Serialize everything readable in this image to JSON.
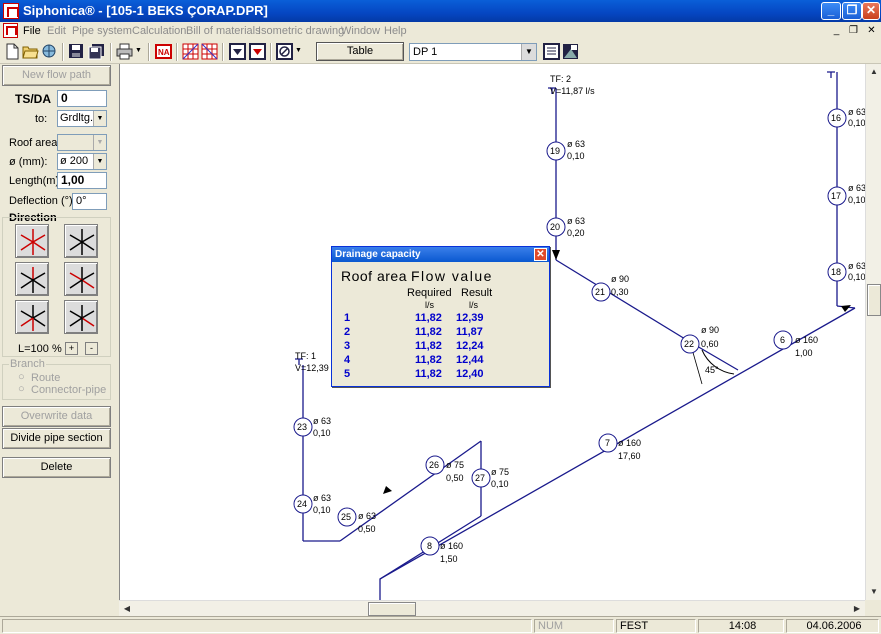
{
  "window": {
    "title": "Siphonica® - [105-1 BEKS ÇORAP.DPR]",
    "minimize": "_",
    "restore": "❐",
    "close": "✕"
  },
  "menu": {
    "items": [
      "File",
      "Edit",
      "Pipe system",
      "Calculation",
      "Bill of materials",
      "Isometric drawing",
      "Window",
      "Help"
    ],
    "mdi_minimize": "_",
    "mdi_restore": "❐",
    "mdi_close": "✕"
  },
  "toolbar": {
    "table_label": "Table",
    "dp_value": "DP 1"
  },
  "left": {
    "new_flow_path": "New flow path",
    "tsda_label": "TS/DA",
    "tsda_value": "0",
    "to_label": "to:",
    "to_value": "Grdltg.",
    "roof_area_label": "Roof area:",
    "roof_area_value": "",
    "diam_label": "ø (mm):",
    "diam_value": "ø 200",
    "length_label": "Length(m) :",
    "length_value": "1,00",
    "deflection_label": "Deflection (°):",
    "deflection_value": "0°",
    "direction_label": "Direction",
    "scale_label": "L=100 %",
    "plus": "+",
    "minus": "-",
    "branch_label": "Branch",
    "route_label": "Route",
    "connector_label": "Connector-pipe",
    "overwrite_data": "Overwrite data",
    "divide_pipe": "Divide pipe section",
    "delete": "Delete"
  },
  "drawing": {
    "tf2_label": "TF: 2",
    "tf2_flow": "V=11,87 l/s",
    "tf1_label": "TF: 1",
    "tf1_flow": "V=12,39",
    "angle_label": "45°",
    "nodes": [
      {
        "id": "16",
        "d": "ø 63",
        "v": "0,10"
      },
      {
        "id": "17",
        "d": "ø 63",
        "v": "0,10"
      },
      {
        "id": "18",
        "d": "ø 63",
        "v": "0,10"
      },
      {
        "id": "19",
        "d": "ø 63",
        "v": "0,10"
      },
      {
        "id": "20",
        "d": "ø 63",
        "v": "0,20"
      },
      {
        "id": "21",
        "d": "ø 90",
        "v": "0,30"
      },
      {
        "id": "22",
        "d": "ø 90",
        "v": "0,60"
      },
      {
        "id": "6",
        "d": "ø 160",
        "v": "1,00"
      },
      {
        "id": "7",
        "d": "ø 160",
        "v": "17,60"
      },
      {
        "id": "8",
        "d": "ø 160",
        "v": "1,50"
      },
      {
        "id": "23",
        "d": "ø 63",
        "v": "0,10"
      },
      {
        "id": "24",
        "d": "ø 63",
        "v": "0,10"
      },
      {
        "id": "25",
        "d": "ø 63",
        "v": "0,50"
      },
      {
        "id": "26",
        "d": "ø 75",
        "v": "0,50"
      },
      {
        "id": "27",
        "d": "ø 75",
        "v": "0,10"
      }
    ]
  },
  "dialog": {
    "title": "Drainage capacity",
    "close": "✕",
    "heading_a": "Roof area",
    "heading_b": "Flow value",
    "col_required": "Required",
    "col_result": "Result",
    "unit_required": "l/s",
    "unit_result": "l/s",
    "rows": [
      {
        "area": "1",
        "required": "11,82",
        "result": "12,39"
      },
      {
        "area": "2",
        "required": "11,82",
        "result": "11,87"
      },
      {
        "area": "3",
        "required": "11,82",
        "result": "12,24"
      },
      {
        "area": "4",
        "required": "11,82",
        "result": "12,44"
      },
      {
        "area": "5",
        "required": "11,82",
        "result": "12,40"
      }
    ]
  },
  "status": {
    "num": "NUM",
    "company": "FEST",
    "time": "14:08",
    "date": "04.06.2006"
  },
  "colors": {
    "pipe": "#1a1a8c",
    "arrow_red": "#cc0000",
    "dialog_values": "#0000cc",
    "title_bar": "#0546c2"
  }
}
